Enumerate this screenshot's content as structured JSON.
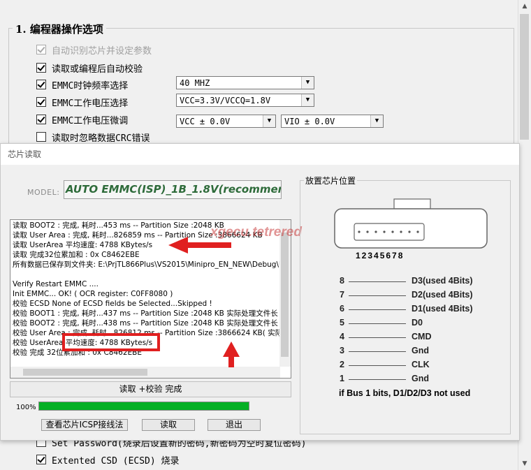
{
  "settings": {
    "group_title": "1. 编程器操作选项",
    "options": [
      {
        "label": "自动识别芯片并设定参数",
        "checked": true,
        "disabled": true
      },
      {
        "label": "读取或编程后自动校验",
        "checked": true,
        "disabled": false
      },
      {
        "label": "EMMC时钟频率选择",
        "checked": true,
        "disabled": false
      },
      {
        "label": "EMMC工作电压选择",
        "checked": true,
        "disabled": false
      },
      {
        "label": "EMMC工作电压微调",
        "checked": true,
        "disabled": false
      },
      {
        "label": "读取时忽略数据CRC错误",
        "checked": false,
        "disabled": false
      }
    ],
    "clock_value": "40 MHZ",
    "voltage_value": "VCC=3.3V/VCCQ=1.8V",
    "vcc_trim_value": "VCC ± 0.0V",
    "vio_trim_value": "VIO ± 0.0V",
    "bottom_options": [
      {
        "label": "Set Password(烧录后设置新的密码,新密码为空时复位密码)",
        "checked": false
      },
      {
        "label": "Extented CSD (ECSD) 烧录",
        "checked": true
      }
    ]
  },
  "dialog": {
    "title": "芯片读取",
    "model_label": "MODEL:",
    "model_value": "AUTO EMMC(ISP)_1B_1.8V(recommend)",
    "log_lines": [
      "读取 BOOT2 : 完成, 耗时...453 ms -- Partition Size :2048 KB",
      "读取 User Area : 完成, 耗时...826859 ms --  Partition Size :3866624 KB",
      "读取 UserArea 平均速度: 4788 KBytes/s",
      "读取 完成32位累加和 : 0x C8462EBE",
      "所有数据已保存到文件夹: E:\\PrjTL866Plus\\VS2015\\Minipro_EN_NEW\\Debug\\U",
      "",
      "Verify Restart EMMC ....",
      "Init EMMC... OK!   ( OCR register: C0FF8080 )",
      "校验 ECSD None of ECSD fields be Selected...Skipped !",
      "校验 BOOT1 : 完成, 耗时...437 ms -- Partition Size :2048 KB 实际处理文件长",
      "校验 BOOT2 : 完成, 耗时...438 ms -- Partition Size :2048 KB 实际处理文件长",
      "校验 User Area : 完成, 耗时...826812 ms -- Partition Size :3866624 KB( 实际处",
      "校验 UserArea 平均速度: 4788 KBytes/s",
      "校验 完成 32位累加和 : 0x C8462EBE"
    ],
    "watermark": "xgecu.tetrered",
    "status_text": "读取 +校验  完成",
    "progress_label": "100%",
    "progress_value": 1.0,
    "buttons": {
      "icsp": "查看芯片ICSP接线法",
      "read": "读取",
      "exit": "退出"
    },
    "chip_panel": {
      "title": "放置芯片位置",
      "pin_numbers": "12345678",
      "pins": [
        {
          "num": "8",
          "label": "D3(used 4Bits)"
        },
        {
          "num": "7",
          "label": "D2(used 4Bits)"
        },
        {
          "num": "6",
          "label": "D1(used 4Bits)"
        },
        {
          "num": "5",
          "label": "D0"
        },
        {
          "num": "4",
          "label": "CMD"
        },
        {
          "num": "3",
          "label": "Gnd"
        },
        {
          "num": "2",
          "label": "CLK"
        },
        {
          "num": "1",
          "label": "Gnd"
        }
      ],
      "bus_note": "if Bus  1 bits, D1/D2/D3 not used"
    }
  },
  "colors": {
    "model_text": "#2e6b3a",
    "annotation_red": "#e02020",
    "progress_fill": "#06b025"
  }
}
